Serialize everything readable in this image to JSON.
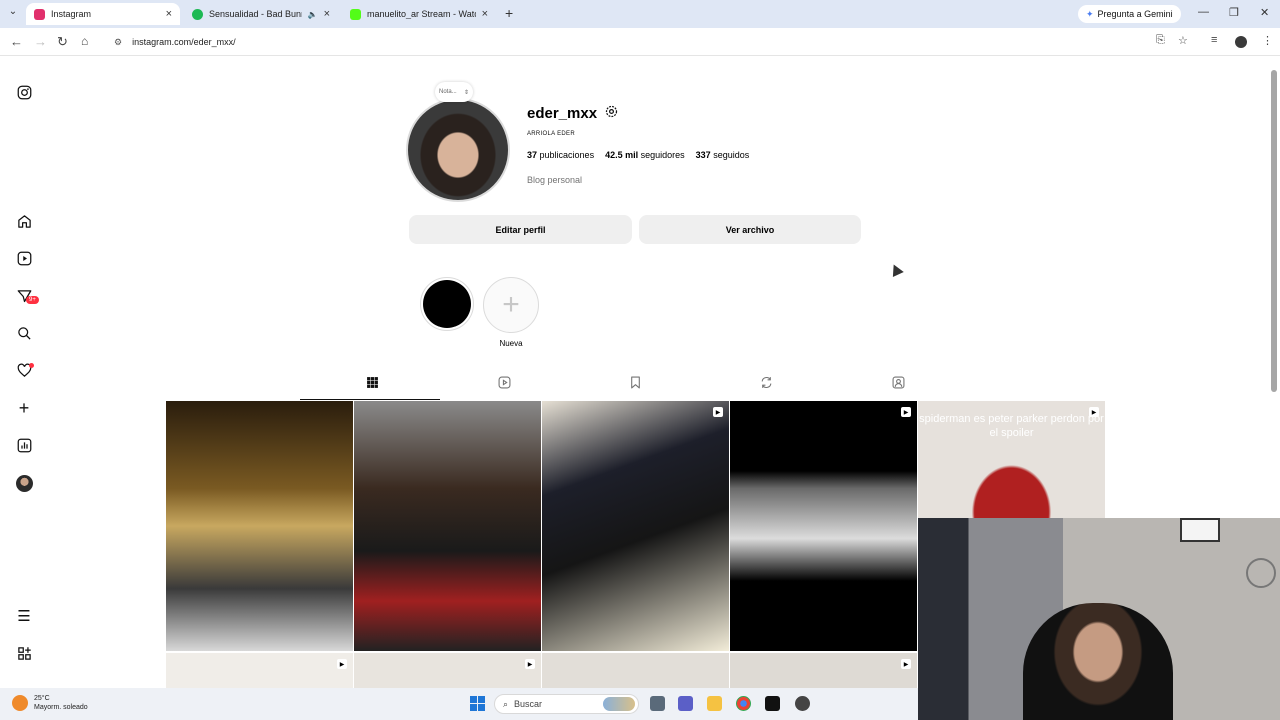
{
  "browser": {
    "tabs": [
      {
        "title": "Instagram",
        "active": true,
        "favicon_color": "#e1306c"
      },
      {
        "title": "Sensualidad - Bad Bunny, P",
        "active": false,
        "favicon_color": "#1db954"
      },
      {
        "title": "manuelito_ar Stream - Watch L",
        "active": false,
        "favicon_color": "#53fc18"
      }
    ],
    "gemini_label": "Pregunta a Gemini",
    "url": "instagram.com/eder_mxx/"
  },
  "profile": {
    "note_label": "Nota...",
    "username": "eder_mxx",
    "full_name": "ARRIOLA EDER",
    "posts_count": "37",
    "posts_label": "publicaciones",
    "followers_count": "42.5 mil",
    "followers_label": "seguidores",
    "following_count": "337",
    "following_label": "seguidos",
    "category": "Blog personal",
    "edit_button": "Editar perfil",
    "archive_button": "Ver archivo"
  },
  "sidebar": {
    "notifications_badge": "9+"
  },
  "highlights": {
    "new_label": "Nueva"
  },
  "posts": [
    {
      "caption": "",
      "reel": false,
      "colors": [
        "#3b2a14",
        "#c9a35a",
        "#1a1a1a"
      ]
    },
    {
      "caption": "",
      "reel": false,
      "colors": [
        "#6e6e6e",
        "#2a2a2a",
        "#c03030"
      ]
    },
    {
      "caption": "",
      "reel": true,
      "colors": [
        "#d9d3c8",
        "#1d1f2a",
        "#f2ecd8"
      ]
    },
    {
      "caption": "",
      "reel": true,
      "colors": [
        "#000000",
        "#9a9a9a",
        "#000000"
      ]
    },
    {
      "caption": "spiderman es peter parker perdon por el spoiler",
      "reel": true,
      "colors": [
        "#e9e4df",
        "#b02020",
        "#d8d2cc"
      ]
    }
  ],
  "taskbar": {
    "temperature": "25°C",
    "weather": "Mayorm. soleado",
    "search_label": "Buscar"
  },
  "colors": {
    "accent": "#0095f6",
    "badge": "#ff3040",
    "button_bg": "#efefef"
  }
}
